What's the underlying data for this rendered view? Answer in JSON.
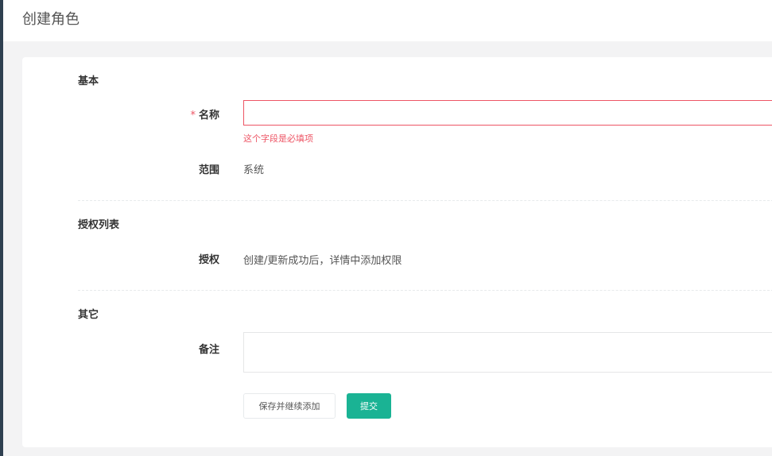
{
  "page": {
    "title": "创建角色"
  },
  "sections": {
    "basic": {
      "title": "基本"
    },
    "auth": {
      "title": "授权列表"
    },
    "other": {
      "title": "其它"
    }
  },
  "fields": {
    "name": {
      "required_mark": "*",
      "label": "名称",
      "value": "",
      "error": "这个字段是必填项"
    },
    "scope": {
      "label": "范围",
      "value": "系统"
    },
    "permission": {
      "label": "授权",
      "value": "创建/更新成功后，详情中添加权限"
    },
    "remark": {
      "label": "备注",
      "value": ""
    }
  },
  "actions": {
    "save_continue_label": "保存并继续添加",
    "submit_label": "提交"
  },
  "colors": {
    "primary": "#1ab394",
    "error": "#ed5565",
    "sidebar": "#2f4050"
  }
}
